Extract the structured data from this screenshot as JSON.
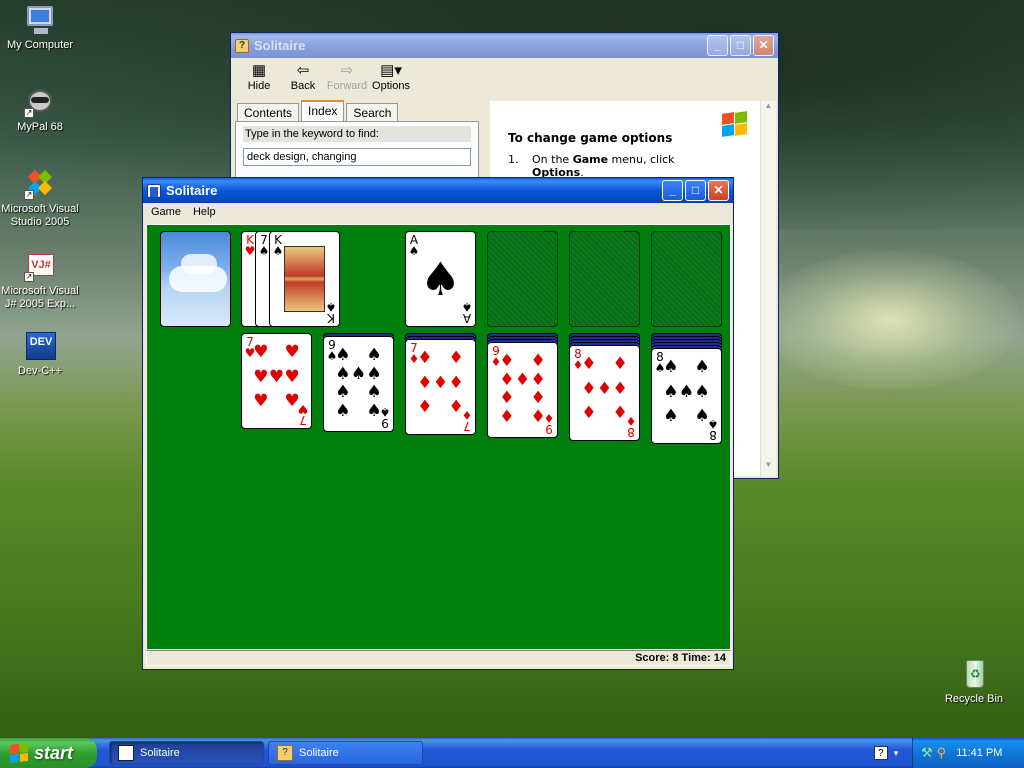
{
  "desktop": {
    "icons": [
      {
        "label": "My Computer",
        "icon": "my-computer-icon"
      },
      {
        "label": "MyPal 68",
        "icon": "mypal-icon"
      },
      {
        "label": "Microsoft Visual Studio 2005",
        "icon": "visual-studio-icon"
      },
      {
        "label": "Microsoft Visual J# 2005 Exp...",
        "icon": "visual-jsharp-icon"
      },
      {
        "label": "Dev-C++",
        "icon": "devcpp-icon"
      },
      {
        "label": "Recycle Bin",
        "icon": "recycle-bin-icon"
      }
    ],
    "devcpp_logo_text": "DEV",
    "vj_logo_text": "VJ#"
  },
  "help_window": {
    "title": "Solitaire",
    "toolbar": {
      "hide": "Hide",
      "back": "Back",
      "forward": "Forward",
      "options": "Options"
    },
    "tabs": [
      "Contents",
      "Index",
      "Search"
    ],
    "active_tab": "Index",
    "keyword_label": "Type in the keyword to find:",
    "keyword_value": "deck design, changing",
    "content": {
      "heading": "To change game options",
      "step_num": "1.",
      "step_prefix": "On the ",
      "step_bold": "Game",
      "step_suffix": " menu, click",
      "step_bold2": "Options",
      "step_end": "."
    }
  },
  "solitaire_window": {
    "title": "Solitaire",
    "menu": [
      "Game",
      "Help"
    ],
    "status": "Score: 8 Time: 14",
    "colors": {
      "felt": "#007f0e"
    },
    "stock": {
      "back_design": "sky-clouds"
    },
    "waste": [
      {
        "rank": "K",
        "suit": "♥",
        "color": "red"
      },
      {
        "rank": "7",
        "suit": "♠",
        "color": "black"
      },
      {
        "rank": "K",
        "suit": "♠",
        "color": "black"
      }
    ],
    "foundations": [
      {
        "rank": "A",
        "suit": "♠",
        "color": "black"
      },
      {
        "empty": true
      },
      {
        "empty": true
      },
      {
        "empty": true
      }
    ],
    "tableau": [
      {
        "hidden": 0,
        "rank": "7",
        "suit": "♥",
        "color": "red"
      },
      {
        "hidden": 1,
        "rank": "9",
        "suit": "♠",
        "color": "black"
      },
      {
        "hidden": 2,
        "rank": "7",
        "suit": "♦",
        "color": "red"
      },
      {
        "hidden": 3,
        "rank": "9",
        "suit": "♦",
        "color": "red"
      },
      {
        "hidden": 4,
        "rank": "8",
        "suit": "♦",
        "color": "red"
      },
      {
        "hidden": 5,
        "rank": "8",
        "suit": "♠",
        "color": "black"
      }
    ]
  },
  "taskbar": {
    "start_label": "start",
    "items": [
      {
        "label": "Solitaire",
        "icon": "solitaire-icon",
        "active": true
      },
      {
        "label": "Solitaire",
        "icon": "help-icon",
        "active": false
      }
    ],
    "clock": "11:41 PM"
  }
}
